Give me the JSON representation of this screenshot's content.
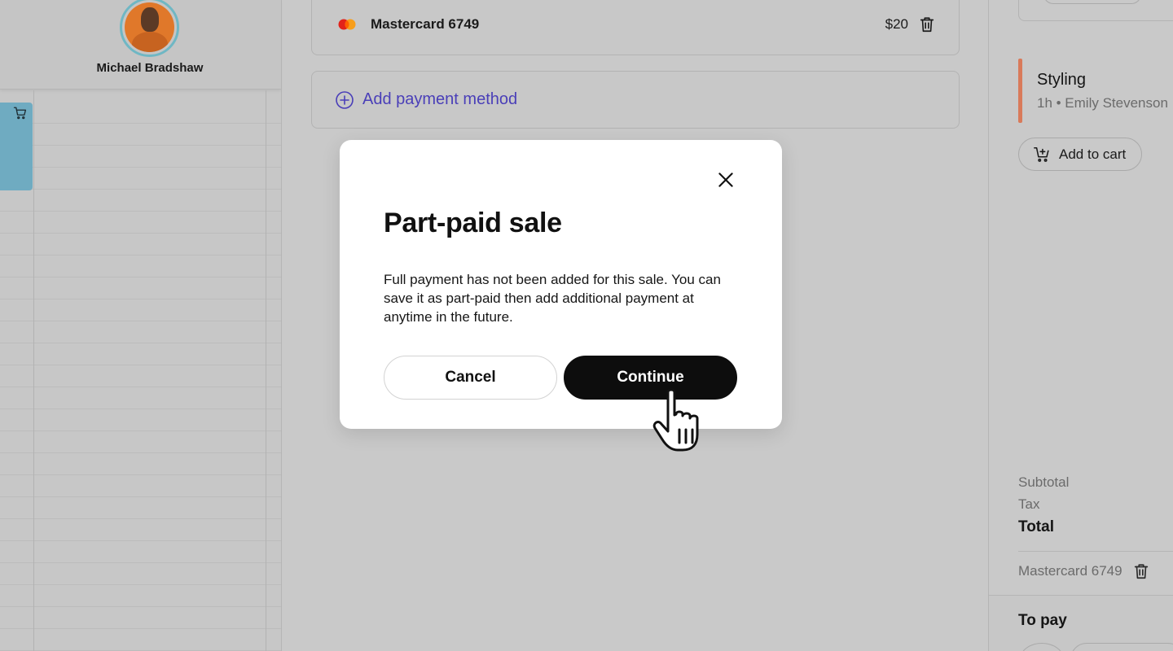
{
  "staff": {
    "name": "Michael Bradshaw"
  },
  "payment": {
    "method_label": "Mastercard 6749",
    "method_amount": "$20",
    "add_label": "Add payment method"
  },
  "summary": {
    "service_name": "Styling",
    "service_meta": "1h • Emily Stevenson",
    "add_to_cart": "Add to cart",
    "subtotal_label": "Subtotal",
    "tax_label": "Tax",
    "total_label": "Total",
    "payment_label": "Mastercard 6749",
    "to_pay_label": "To pay"
  },
  "modal": {
    "title": "Part-paid sale",
    "body": "Full payment has not been added for this sale. You can save it as part-paid then add additional payment at anytime in the future.",
    "cancel_label": "Cancel",
    "continue_label": "Continue"
  },
  "colors": {
    "overlay_bg": "#c9c9c9",
    "accent_link": "#4a3fb8",
    "service_bar": "#d97a5a",
    "calendar_block": "#6fabc1",
    "primary_button": "#0d0d0d"
  },
  "icons": [
    "cart-icon",
    "mastercard-logo",
    "trash-icon",
    "plus-circle-icon",
    "close-icon",
    "hand-pointer-icon"
  ]
}
